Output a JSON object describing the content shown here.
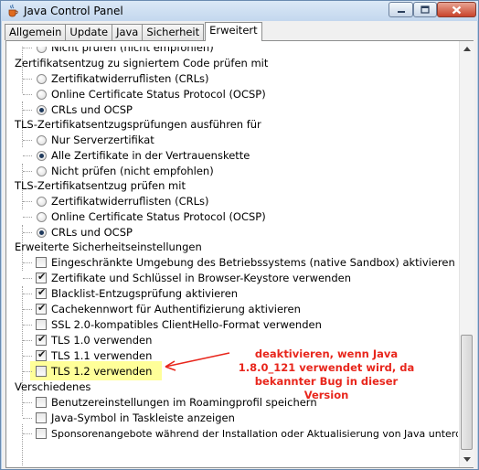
{
  "window": {
    "title": "Java Control Panel",
    "icon": "java-cup-icon"
  },
  "tabs": [
    {
      "label": "Allgemein",
      "active": false
    },
    {
      "label": "Update",
      "active": false
    },
    {
      "label": "Java",
      "active": false
    },
    {
      "label": "Sicherheit",
      "active": false
    },
    {
      "label": "Erweitert",
      "active": true
    }
  ],
  "settings": {
    "partial_top": "Nicht prüfen (nicht empfohlen)",
    "signed_code": {
      "heading": "Zertifikatsentzug zu signiertem Code prüfen mit",
      "options": [
        "Zertifikatwiderruflisten (CRLs)",
        "Online Certificate Status Protocol (OCSP)",
        "CRLs und OCSP"
      ],
      "selected": 2
    },
    "tls_checks": {
      "heading": "TLS-Zertifikatsentzugsprüfungen ausführen für",
      "options": [
        "Nur Serverzertifikat",
        "Alle Zertifikate in der Vertrauenskette",
        "Nicht prüfen (nicht empfohlen)"
      ],
      "selected": 1
    },
    "tls_revocation": {
      "heading": "TLS-Zertifikatsentzug prüfen mit",
      "options": [
        "Zertifikatwiderruflisten (CRLs)",
        "Online Certificate Status Protocol (OCSP)",
        "CRLs und OCSP"
      ],
      "selected": 2
    },
    "advanced_security": {
      "heading": "Erweiterte Sicherheitseinstellungen",
      "items": [
        {
          "label": "Eingeschränkte Umgebung des Betriebssystems (native Sandbox) aktivieren",
          "checked": false
        },
        {
          "label": "Zertifikate und Schlüssel in Browser-Keystore verwenden",
          "checked": true
        },
        {
          "label": "Blacklist-Entzugsprüfung aktivieren",
          "checked": true
        },
        {
          "label": "Cachekennwort für Authentifizierung aktivieren",
          "checked": true
        },
        {
          "label": "SSL 2.0-kompatibles ClientHello-Format verwenden",
          "checked": false
        },
        {
          "label": "TLS 1.0 verwenden",
          "checked": true
        },
        {
          "label": "TLS 1.1 verwenden",
          "checked": true
        },
        {
          "label": "TLS 1.2 verwenden",
          "checked": false
        }
      ]
    },
    "misc": {
      "heading": "Verschiedenes",
      "items": [
        {
          "label": "Benutzereinstellungen im Roamingprofil speichern",
          "checked": false
        },
        {
          "label": "Java-Symbol in Taskleiste anzeigen",
          "checked": false
        },
        {
          "label": "Sponsorenangebote während der Installation oder Aktualisierung von Java unterdrücken",
          "checked": false
        }
      ]
    }
  },
  "annotation": {
    "line1": "deaktivieren, wenn Java",
    "line2": "1.8.0_121 verwendet wird, da",
    "line3": "bekannter Bug in dieser Version",
    "color": "#e8261c"
  },
  "highlight_color": "#ffff99"
}
